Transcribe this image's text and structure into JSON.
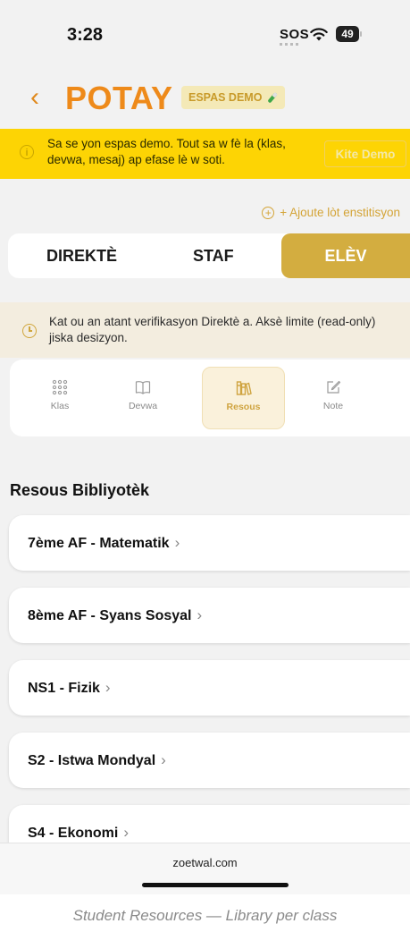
{
  "status_bar": {
    "time": "3:28",
    "sos": "SOS",
    "battery": "49"
  },
  "header": {
    "back_glyph": "‹",
    "title": "POTAY",
    "demo_badge": "ESPAS DEMO"
  },
  "demo_banner": {
    "text": "Sa se yon espas demo. Tout sa w fè la (klas, devwa, mesaj) ap efase lè w soti.",
    "exit_button": "Kite Demo"
  },
  "add_institution": "+ Ajoute lòt enstitisyon",
  "roles": [
    "DIREKTÈ",
    "STAF",
    "ELÈV"
  ],
  "active_role": "ELÈV",
  "pending_notice": "Kat ou an atant verifikasyon Direktè a. Aksè limite (read-only) jiska desizyon.",
  "sections": [
    {
      "label": "Klas",
      "icon": "grid-icon"
    },
    {
      "label": "Devwa",
      "icon": "book-icon"
    },
    {
      "label": "Resous",
      "icon": "library-icon"
    },
    {
      "label": "Note",
      "icon": "edit-icon"
    }
  ],
  "active_section": "Resous",
  "resources": {
    "title": "Resous Bibliyotèk",
    "items": [
      "7ème AF - Matematik",
      "8ème AF - Syans Sosyal",
      "NS1 - Fizik",
      "S2 - Istwa Mondyal",
      "S4 - Ekonomi"
    ]
  },
  "browser": {
    "url": "zoetwal.com"
  },
  "caption": "Student Resources — Library per class",
  "colors": {
    "accent": "#d3ad40",
    "brand": "#ee8a1a",
    "banner": "#fdd404"
  }
}
